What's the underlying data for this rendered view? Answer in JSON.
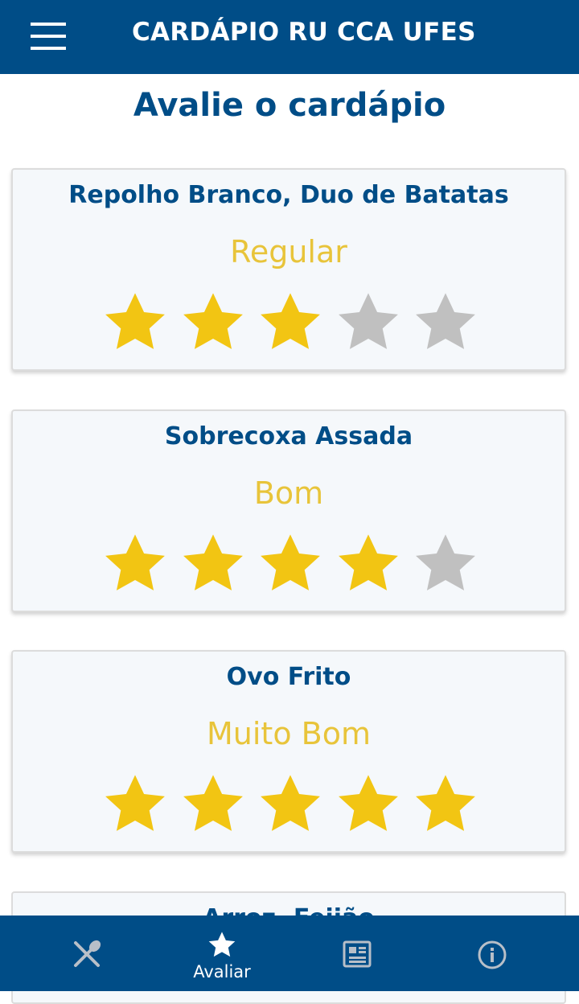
{
  "app_bar": {
    "title": "CARDÁPIO RU CCA UFES",
    "menu_icon": "hamburger-menu-icon"
  },
  "page": {
    "title": "Avalie o cardápio"
  },
  "colors": {
    "primary": "#004d87",
    "rating_text": "#e8c43a",
    "star_filled": "#f2c513",
    "star_empty": "#c0c0c0"
  },
  "items": [
    {
      "name": "Repolho Branco, Duo de Batatas",
      "rating_label": "Regular",
      "stars": 3,
      "max_stars": 5
    },
    {
      "name": "Sobrecoxa Assada",
      "rating_label": "Bom",
      "stars": 4,
      "max_stars": 5
    },
    {
      "name": "Ovo Frito",
      "rating_label": "Muito Bom",
      "stars": 5,
      "max_stars": 5
    }
  ],
  "partial_item": {
    "name": "Arroz, Feijão"
  },
  "bottom_nav": [
    {
      "icon": "fork-knife-icon",
      "label": "",
      "active": false
    },
    {
      "icon": "star-icon",
      "label": "Avaliar",
      "active": true
    },
    {
      "icon": "newspaper-icon",
      "label": "",
      "active": false
    },
    {
      "icon": "info-icon",
      "label": "",
      "active": false
    }
  ]
}
